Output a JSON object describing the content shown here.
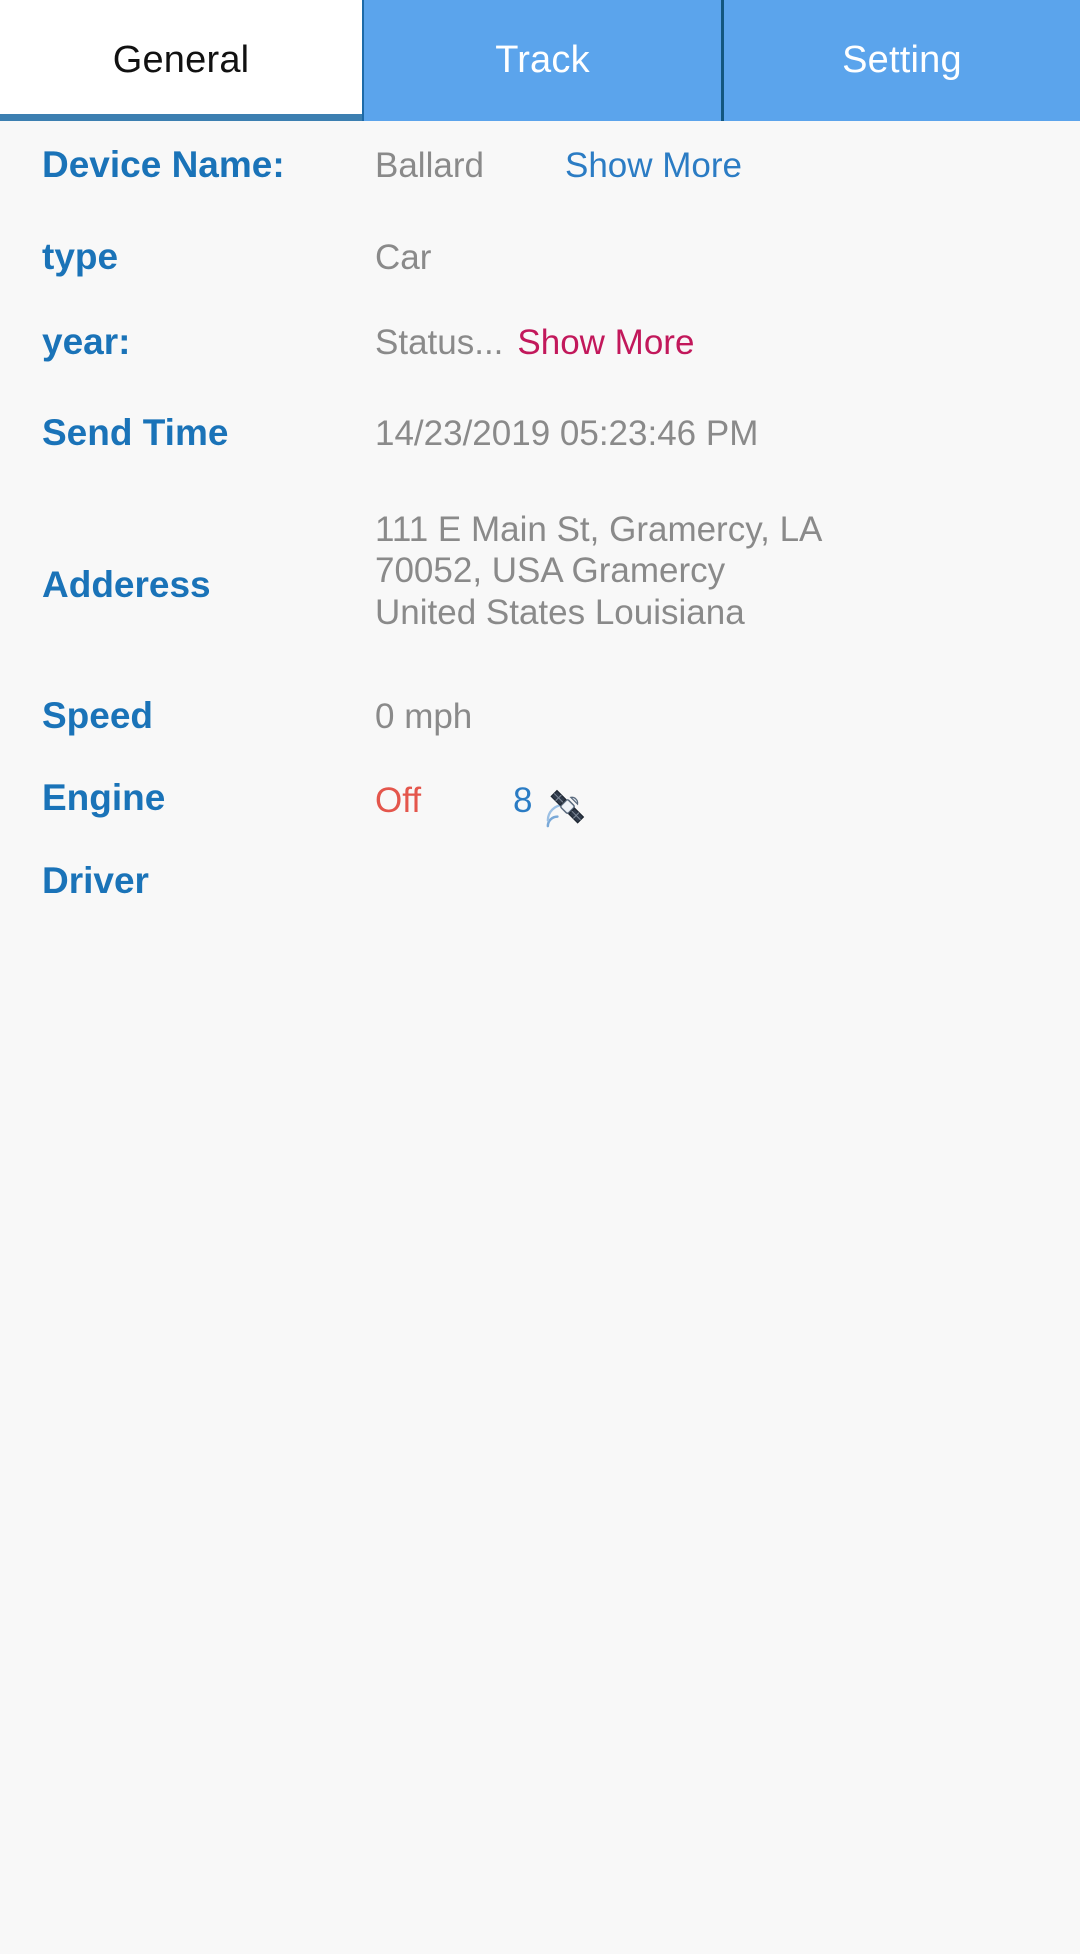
{
  "tabs": [
    {
      "id": "general",
      "label": "General",
      "active": true
    },
    {
      "id": "track",
      "label": "Track",
      "active": false
    },
    {
      "id": "setting",
      "label": "Setting",
      "active": false
    }
  ],
  "colors": {
    "tab_bar_blue": "#5ba4ec",
    "active_tab_bg": "#ffffff",
    "active_tab_underline": "#3c7fb1",
    "label_blue": "#1a73b8",
    "value_gray": "#8a8a8a",
    "link_blue": "#2b7cc4",
    "link_crimson": "#c2185b",
    "engine_off_red": "#e4564c",
    "page_background": "#f8f8f8"
  },
  "details": {
    "device_name": {
      "label": "Device Name:",
      "value": "Ballard",
      "action": "Show More"
    },
    "type": {
      "label": "type",
      "value": "Car"
    },
    "year": {
      "label": "year:",
      "value": "Status...",
      "action": "Show More"
    },
    "send_time": {
      "label": "Send Time",
      "value": "14/23/2019 05:23:46 PM"
    },
    "address": {
      "label": "Adderess",
      "line1": "111 E Main St, Gramercy, LA",
      "line2": "70052, USA Gramercy",
      "line3": "United States Louisiana"
    },
    "speed": {
      "label": "Speed",
      "value": "0 mph"
    },
    "engine": {
      "label": "Engine",
      "value": "Off",
      "satellite_count": "8",
      "satellite_icon": "satellite-icon"
    },
    "driver": {
      "label": "Driver",
      "value": ""
    }
  }
}
